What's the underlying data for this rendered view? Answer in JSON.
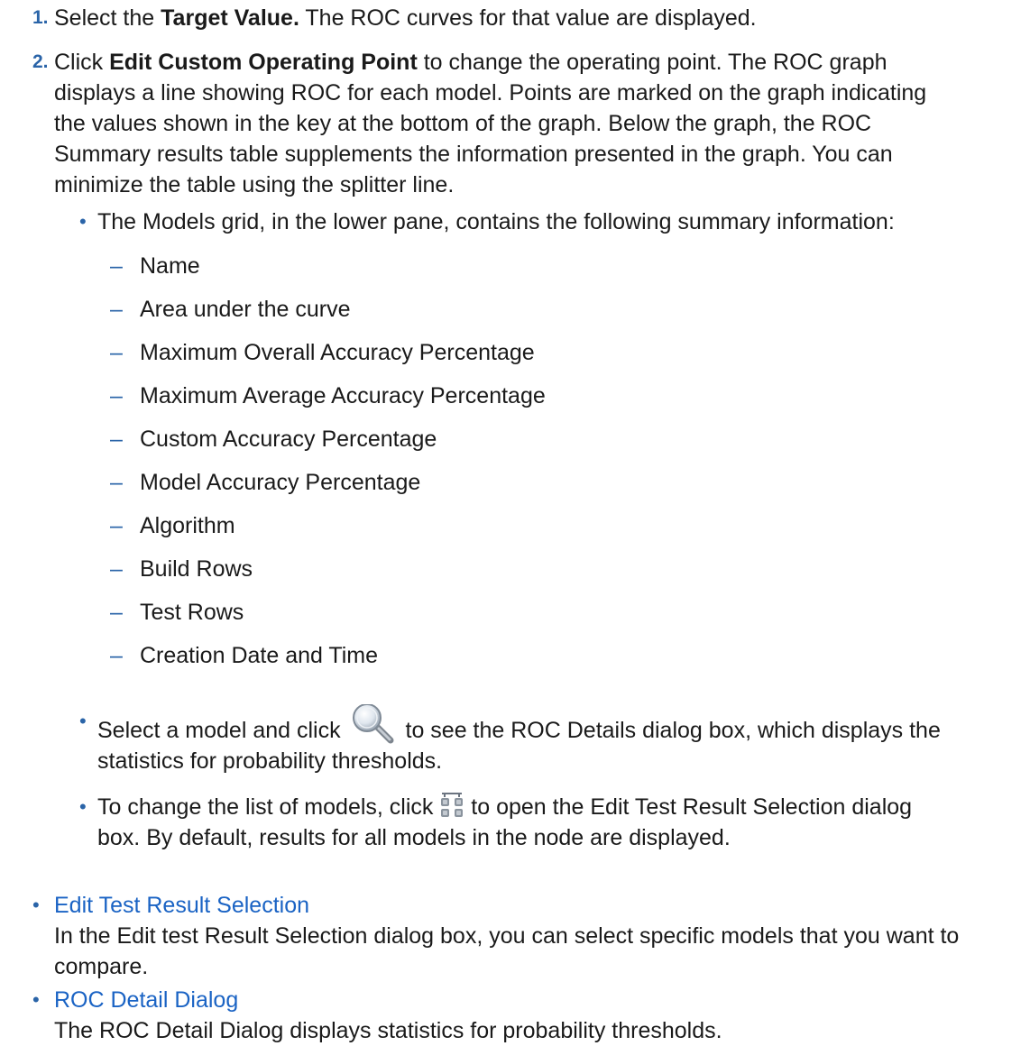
{
  "step1": {
    "number": "1.",
    "prefix": "Select the ",
    "bold": "Target Value.",
    "suffix": " The ROC curves for that value are displayed."
  },
  "step2": {
    "number": "2.",
    "prefix": "Click ",
    "bold": "Edit Custom Operating Point",
    "line1_rest": " to change the operating point. The ROC graph",
    "line2": "displays a line showing ROC for each model. Points are marked on the graph indicating",
    "line3": "the values shown in the key at the bottom of the graph. Below the graph, the ROC",
    "line4": "Summary results table supplements the information presented in the graph. You can",
    "line5": "minimize the table using the splitter line."
  },
  "models_grid": {
    "intro": "The Models grid, in the lower pane, contains the following summary information:",
    "items": [
      "Name",
      "Area under the curve",
      "Maximum Overall Accuracy Percentage",
      "Maximum Average Accuracy Percentage",
      "Custom Accuracy Percentage",
      "Model Accuracy Percentage",
      "Algorithm",
      "Build Rows",
      "Test Rows",
      "Creation Date and Time"
    ]
  },
  "select_model": {
    "before": "Select a model and click",
    "after": " to see the ROC Details dialog box, which displays the",
    "line2": "statistics for probability thresholds.",
    "icon": "magnifier-icon"
  },
  "change_list": {
    "before": "To change the list of models, click ",
    "after": " to open the Edit Test Result Selection dialog",
    "line2": "box. By default, results for all models in the node are displayed.",
    "icon": "test-result-selection-icon"
  },
  "links": [
    {
      "label": "Edit Test Result Selection",
      "desc1": "In the Edit test Result Selection dialog box, you can select specific models that you want to",
      "desc2": "compare."
    },
    {
      "label": "ROC Detail Dialog",
      "desc1": "The ROC Detail Dialog displays statistics for probability thresholds."
    }
  ],
  "colors": {
    "accent": "#2a64a8",
    "link": "#1a63c4",
    "text": "#1a1a1a"
  }
}
